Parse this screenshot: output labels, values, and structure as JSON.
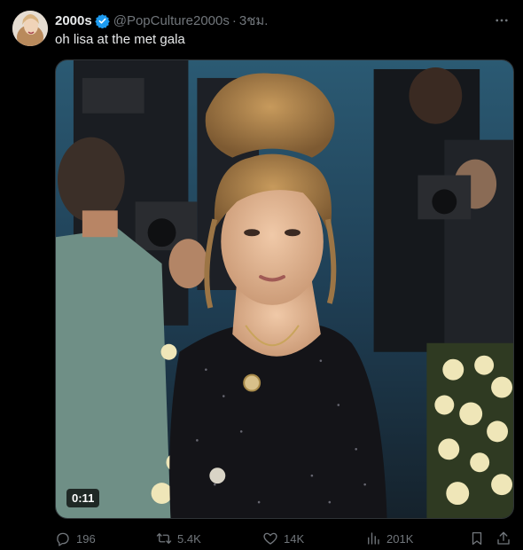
{
  "author": {
    "display_name": "2000s",
    "handle": "@PopCulture2000s",
    "separator": "·",
    "time": "3ชม."
  },
  "tweet": {
    "text": "oh lisa at the met gala"
  },
  "media": {
    "type": "video",
    "duration": "0:11"
  },
  "actions": {
    "replies": "196",
    "reposts": "5.4K",
    "likes": "14K",
    "views": "201K"
  },
  "icons": {
    "verified": "verified-badge-icon",
    "more": "more-icon",
    "reply": "reply-icon",
    "repost": "repost-icon",
    "like": "heart-icon",
    "views": "views-icon",
    "bookmark": "bookmark-icon",
    "share": "share-icon"
  },
  "colors": {
    "background": "#000000",
    "text": "#e7e9ea",
    "muted": "#71767b",
    "verified": "#1d9bf0"
  }
}
